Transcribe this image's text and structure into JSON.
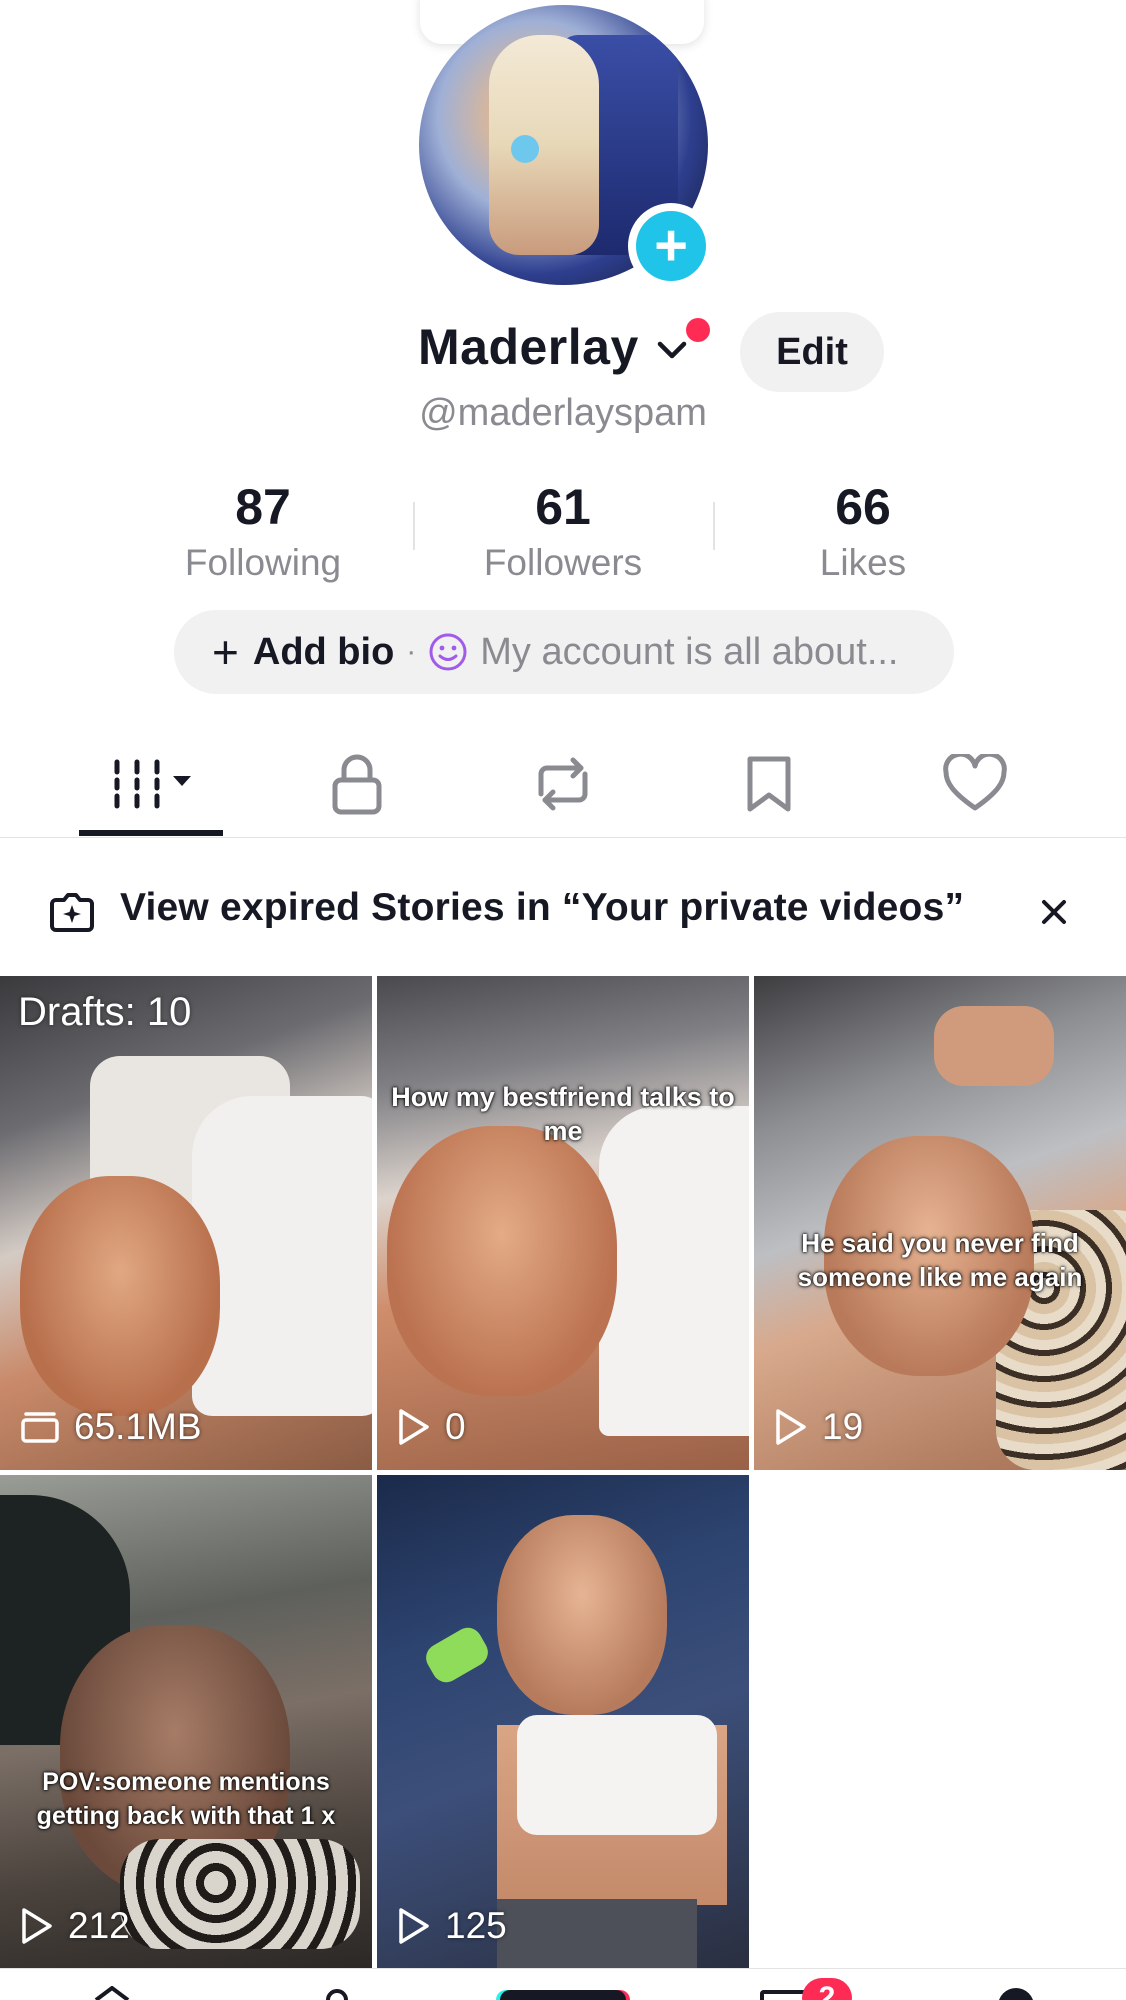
{
  "profile": {
    "username": "Maderlay",
    "handle": "@maderlayspam",
    "edit_label": "Edit"
  },
  "stats": [
    {
      "value": "87",
      "label": "Following"
    },
    {
      "value": "61",
      "label": "Followers"
    },
    {
      "value": "66",
      "label": "Likes"
    }
  ],
  "bio": {
    "add_label": "Add bio",
    "separator": "·",
    "placeholder": "My account is all about..."
  },
  "tabs": [
    {
      "icon": "videos-grid-icon",
      "active": true
    },
    {
      "icon": "lock-icon",
      "active": false
    },
    {
      "icon": "repost-icon",
      "active": false
    },
    {
      "icon": "bookmark-icon",
      "active": false
    },
    {
      "icon": "heart-icon",
      "active": false
    }
  ],
  "banner": {
    "text": "View expired Stories in “Your private videos”"
  },
  "grid": {
    "drafts": {
      "label": "Drafts: 10",
      "size": "65.1MB"
    },
    "videos": [
      {
        "caption": "How my bestfriend talks to me",
        "views": "0"
      },
      {
        "caption": "He said you never find someone like me again",
        "views": "19"
      },
      {
        "caption": "POV:someone mentions getting back with that 1 x",
        "views": "212"
      },
      {
        "caption": "",
        "views": "125"
      }
    ]
  },
  "bottom_nav": {
    "inbox_badge": "2"
  },
  "colors": {
    "accent_red": "#fe2c55",
    "accent_cyan": "#20c4e8",
    "text_primary": "#161823",
    "text_secondary": "#8a8b91",
    "pill_bg": "#f1f1f2"
  }
}
